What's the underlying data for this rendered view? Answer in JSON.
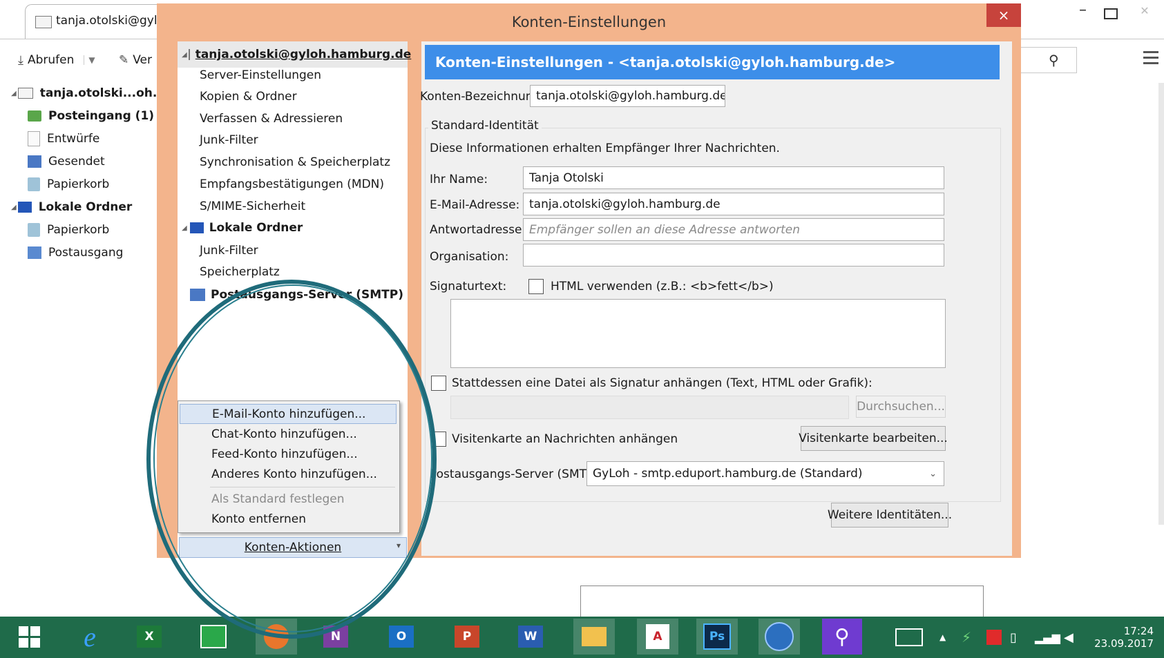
{
  "background_window": {
    "tab_title": "tanja.otolski@gyl",
    "toolbar": {
      "fetch_label": "Abrufen",
      "compose_label": "Ver"
    },
    "folders": [
      {
        "label": "tanja.otolski...oh.ha",
        "bold": true,
        "icon": "account-icon"
      },
      {
        "label": "Posteingang (1)",
        "bold": true,
        "icon": "inbox-icon"
      },
      {
        "label": "Entwürfe",
        "bold": false,
        "icon": "drafts-icon"
      },
      {
        "label": "Gesendet",
        "bold": false,
        "icon": "sent-icon"
      },
      {
        "label": "Papierkorb",
        "bold": false,
        "icon": "trash-icon"
      },
      {
        "label": "Lokale Ordner",
        "bold": true,
        "icon": "local-folders-icon"
      },
      {
        "label": "Papierkorb",
        "bold": false,
        "icon": "trash-icon"
      },
      {
        "label": "Postausgang",
        "bold": false,
        "icon": "outbox-icon"
      }
    ]
  },
  "dialog": {
    "title": "Konten-Einstellungen",
    "close_label": "×",
    "tree": {
      "account": "tanja.otolski@gyloh.hamburg.de",
      "items": [
        "Server-Einstellungen",
        "Kopien & Ordner",
        "Verfassen & Adressieren",
        "Junk-Filter",
        "Synchronisation & Speicherplatz",
        "Empfangsbestätigungen (MDN)",
        "S/MIME-Sicherheit"
      ],
      "local_folders": "Lokale Ordner",
      "local_items": [
        "Junk-Filter",
        "Speicherplatz"
      ],
      "smtp": "Postausgangs-Server (SMTP)"
    },
    "account_actions_label": "Konten-Aktionen",
    "content": {
      "header": "Konten-Einstellungen - <tanja.otolski@gyloh.hamburg.de>",
      "account_name_label": "Konten-Bezeichnung:",
      "account_name_value": "tanja.otolski@gyloh.hamburg.de",
      "identity_group": "Standard-Identität",
      "identity_desc": "Diese Informationen erhalten Empfänger Ihrer Nachrichten.",
      "name_label": "Ihr Name:",
      "name_value": "Tanja Otolski",
      "email_label": "E-Mail-Adresse:",
      "email_value": "tanja.otolski@gyloh.hamburg.de",
      "reply_label": "Antwortadresse:",
      "reply_placeholder": "Empfänger sollen an diese Adresse antworten",
      "org_label": "Organisation:",
      "org_value": "",
      "signature_label": "Signaturtext:",
      "html_checkbox_label": "HTML verwenden (z.B.: <b>fett</b>)",
      "file_signature_label": "Stattdessen eine Datei als Signatur anhängen (Text, HTML oder Grafik):",
      "browse_label": "Durchsuchen...",
      "vcard_label": "Visitenkarte an Nachrichten anhängen",
      "vcard_edit_label": "Visitenkarte bearbeiten...",
      "smtp_label": "Postausgangs-Server (SMTP):",
      "smtp_value": "GyLoh - smtp.eduport.hamburg.de (Standard)",
      "more_identities_label": "Weitere Identitäten..."
    }
  },
  "context_menu": {
    "items": [
      {
        "label": "E-Mail-Konto hinzufügen...",
        "state": "highlighted"
      },
      {
        "label": "Chat-Konto hinzufügen...",
        "state": "normal"
      },
      {
        "label": "Feed-Konto hinzufügen...",
        "state": "normal"
      },
      {
        "label": "Anderes Konto hinzufügen...",
        "state": "normal"
      },
      {
        "label": "Als Standard festlegen",
        "state": "disabled"
      },
      {
        "label": "Konto entfernen",
        "state": "normal"
      }
    ]
  },
  "taskbar": {
    "time": "17:24",
    "date": "23.09.2017",
    "accent_color": "#1f6b4a"
  }
}
